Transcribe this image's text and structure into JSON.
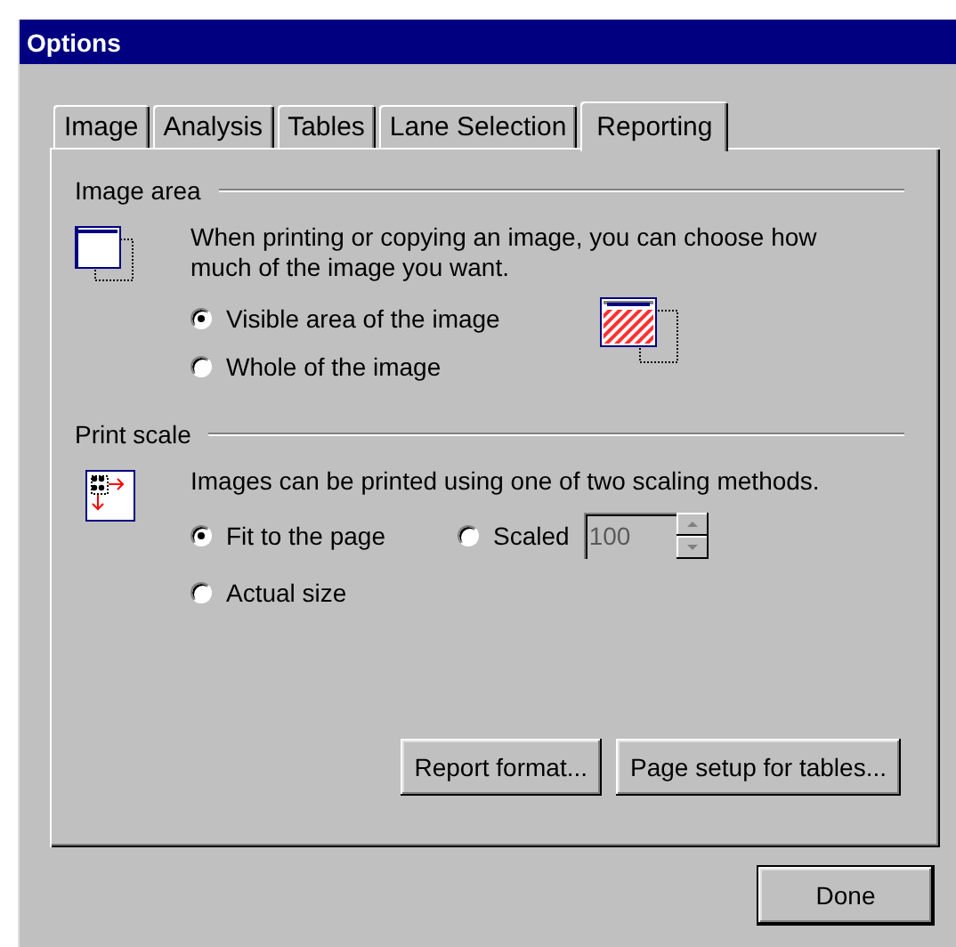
{
  "window": {
    "title": "Options"
  },
  "tabs": [
    {
      "label": "Image",
      "selected": false
    },
    {
      "label": "Analysis",
      "selected": false
    },
    {
      "label": "Tables",
      "selected": false
    },
    {
      "label": "Lane Selection",
      "selected": false
    },
    {
      "label": "Reporting",
      "selected": true
    }
  ],
  "image_area": {
    "heading": "Image area",
    "description": "When printing or copying an image, you can choose how much of the image you want.",
    "options": [
      {
        "label": "Visible area of the image",
        "selected": true
      },
      {
        "label": "Whole of the image",
        "selected": false
      }
    ]
  },
  "print_scale": {
    "heading": "Print scale",
    "description": "Images can be printed using one of two scaling methods.",
    "options": [
      {
        "label": "Fit to the page",
        "selected": true
      },
      {
        "label": "Scaled",
        "selected": false
      },
      {
        "label": "Actual size",
        "selected": false
      }
    ],
    "scale_field": {
      "value": "100",
      "disabled": true
    }
  },
  "buttons": [
    {
      "label": "Report format..."
    },
    {
      "label": "Page setup for tables..."
    }
  ],
  "done_button": {
    "label": "Done",
    "default": true
  }
}
